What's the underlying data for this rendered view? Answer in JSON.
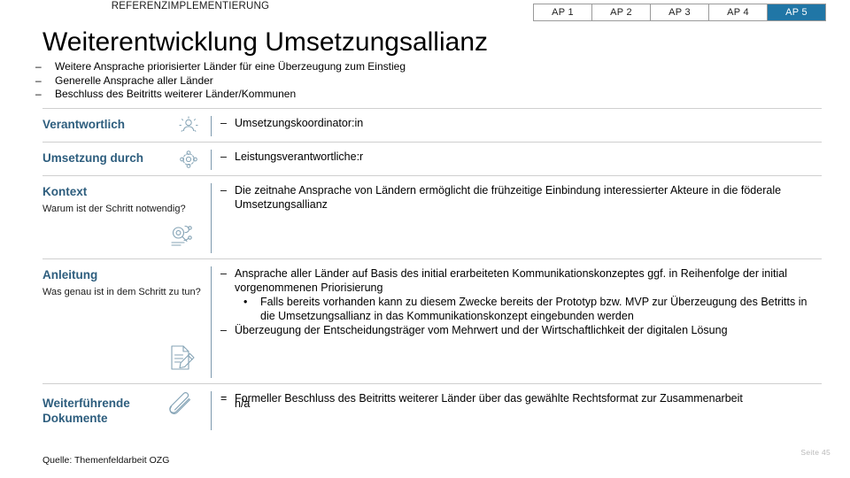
{
  "header": {
    "eyebrow": "REFERENZIMPLEMENTIERUNG",
    "title": "Weiterentwicklung Umsetzungsallianz"
  },
  "tabs": {
    "items": [
      {
        "label": "AP 1",
        "active": false
      },
      {
        "label": "AP 2",
        "active": false
      },
      {
        "label": "AP 3",
        "active": false
      },
      {
        "label": "AP 4",
        "active": false
      },
      {
        "label": "AP 5",
        "active": true
      }
    ],
    "active_color": "#2076a6"
  },
  "intro": {
    "marker": "–",
    "items": [
      "Weitere Ansprache priorisierter Länder für eine Überzeugung zum Einstieg",
      "Generelle Ansprache aller Länder",
      "Beschluss des Beitritts weiterer Länder/Kommunen"
    ]
  },
  "rows": {
    "verantwortlich": {
      "label": "Verantwortlich",
      "icon": "person-network-icon",
      "bullets": [
        {
          "marker": "–",
          "text": "Umsetzungskoordinator:in"
        }
      ]
    },
    "umsetzung_durch": {
      "label": "Umsetzung durch",
      "icon": "gear-people-icon",
      "bullets": [
        {
          "marker": "–",
          "text": "Leistungsverantwortliche:r"
        }
      ]
    },
    "kontext": {
      "label": "Kontext",
      "sub": "Warum ist der Schritt notwendig?",
      "icon": "magnifier-search-icon",
      "bullets": [
        {
          "marker": "–",
          "text": "Die zeitnahe Ansprache von Ländern ermöglicht die frühzeitige Einbindung interessierter Akteure in die föderale Umsetzungsallianz"
        }
      ]
    },
    "anleitung": {
      "label": "Anleitung",
      "sub": "Was genau ist in dem Schritt zu tun?",
      "icon": "document-pencil-icon",
      "bullets": [
        {
          "marker": "–",
          "text": "Ansprache aller Länder auf Basis des initial erarbeiteten Kommunikationskonzeptes ggf. in Reihenfolge der initial vorgenommenen Priorisierung"
        }
      ],
      "sub_bullets": [
        {
          "marker": "•",
          "text": "Falls bereits vorhanden kann zu diesem Zwecke bereits der Prototyp bzw. MVP zur Überzeugung des Betritts in die Umsetzungsallianz in das Kommunikationskonzept eingebunden werden"
        }
      ],
      "bullets_after": [
        {
          "marker": "–",
          "text": "Überzeugung der Entscheidungsträger vom Mehrwert und der Wirtschaftlichkeit der digitalen Lösung"
        }
      ]
    },
    "weiterfuehrende_dokumente": {
      "label_line1": "Weiterführende",
      "label_line2": "Dokumente",
      "icon": "paperclip-icon",
      "overlap_text": "n/a",
      "bullets": [
        {
          "marker": "=",
          "text": "Formeller Beschluss des Beitritts weiterer Länder über das gewählte Rechtsformat zur Zusammenarbeit"
        }
      ]
    }
  },
  "footer": {
    "source": "Quelle: Themenfeldarbeit OZG",
    "page": "Seite 45"
  }
}
